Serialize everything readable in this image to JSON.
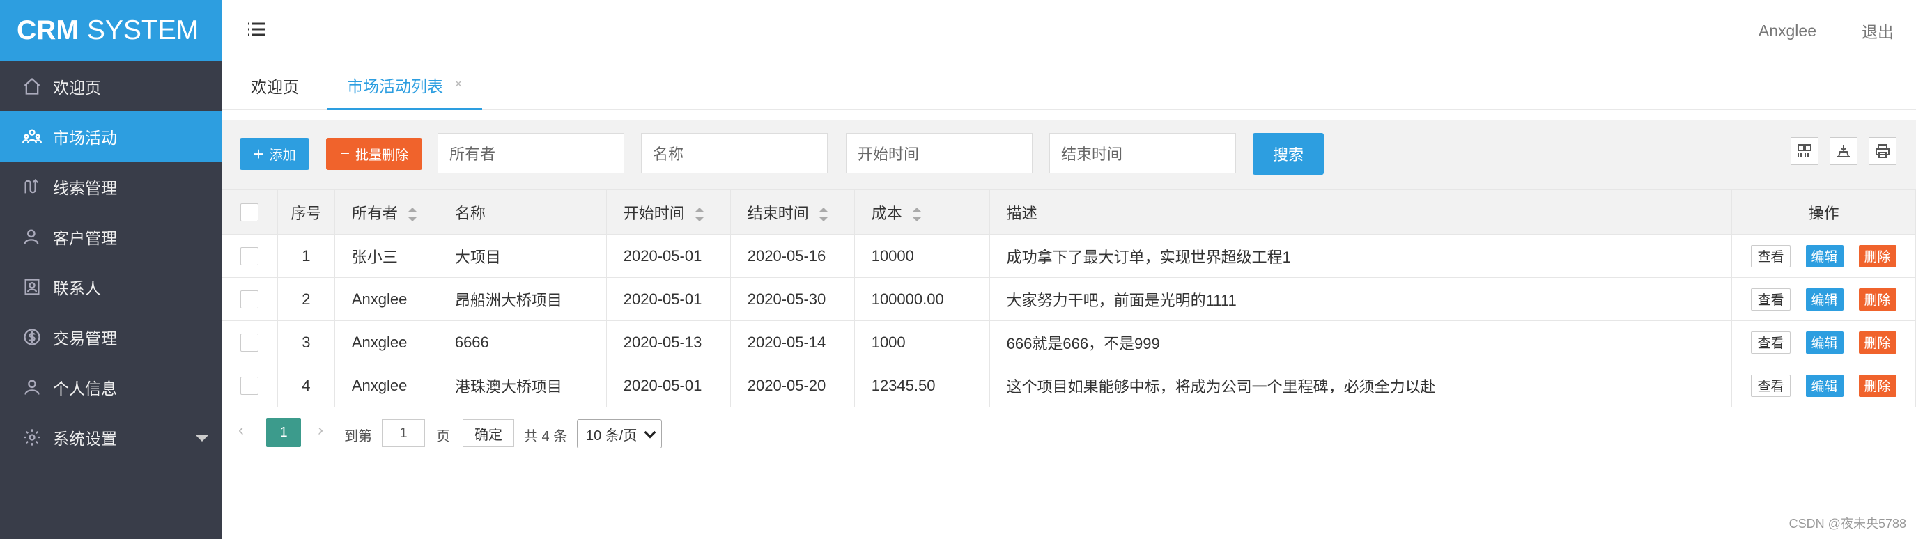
{
  "app": {
    "logo_bold": "CRM",
    "logo_rest": "SYSTEM"
  },
  "sidebar": {
    "items": [
      {
        "label": "欢迎页",
        "icon": "home-icon"
      },
      {
        "label": "市场活动",
        "icon": "users-icon",
        "active": true
      },
      {
        "label": "线索管理",
        "icon": "path-icon"
      },
      {
        "label": "客户管理",
        "icon": "user-icon"
      },
      {
        "label": "联系人",
        "icon": "contact-card-icon"
      },
      {
        "label": "交易管理",
        "icon": "coin-icon"
      },
      {
        "label": "个人信息",
        "icon": "person-icon"
      },
      {
        "label": "系统设置",
        "icon": "gear-icon"
      }
    ]
  },
  "header": {
    "user": "Anxglee",
    "logout": "退出"
  },
  "tabs": {
    "welcome": "欢迎页",
    "market": "市场活动列表",
    "close": "×"
  },
  "toolbar": {
    "add": "添加",
    "bulk_delete": "批量删除",
    "owner_placeholder": "所有者",
    "name_placeholder": "名称",
    "start_placeholder": "开始时间",
    "end_placeholder": "结束时间",
    "search": "搜索"
  },
  "table": {
    "headers": [
      "序号",
      "所有者",
      "名称",
      "开始时间",
      "结束时间",
      "成本",
      "描述",
      "操作"
    ],
    "rows": [
      [
        "1",
        "张小三",
        "大项目",
        "2020-05-01",
        "2020-05-16",
        "10000",
        "成功拿下了最大订单，实现世界超级工程1"
      ],
      [
        "2",
        "Anxglee",
        "昂船洲大桥项目",
        "2020-05-01",
        "2020-05-30",
        "100000.00",
        "大家努力干吧，前面是光明的1111"
      ],
      [
        "3",
        "Anxglee",
        "6666",
        "2020-05-13",
        "2020-05-14",
        "1000",
        "666就是666，不是999"
      ],
      [
        "4",
        "Anxglee",
        "港珠澳大桥项目",
        "2020-05-01",
        "2020-05-20",
        "12345.50",
        "这个项目如果能够中标，将成为公司一个里程碑，必须全力以赴"
      ]
    ],
    "ops": {
      "view": "查看",
      "edit": "编辑",
      "delete": "删除"
    }
  },
  "pager": {
    "prev": "‹",
    "current": "1",
    "next": "›",
    "goto_label": "到第",
    "goto_value": "1",
    "page_label": "页",
    "confirm": "确定",
    "total": "共 4 条",
    "per_page": "10 条/页"
  },
  "watermark": "CSDN @夜未央5788",
  "colors": {
    "accent": "#2d9ee0",
    "danger": "#f0632c",
    "sidebar": "#393d49",
    "pager_active": "#3c9b8c"
  }
}
